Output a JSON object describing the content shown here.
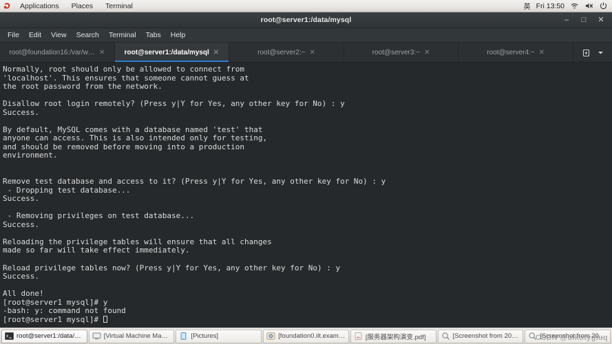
{
  "topbar": {
    "logo_icon": "fedora-logo-icon",
    "menus": [
      {
        "label": "Applications"
      },
      {
        "label": "Places"
      },
      {
        "label": "Terminal"
      }
    ],
    "ime_indicator": "英",
    "clock": "Fri 13:50",
    "icons": [
      {
        "name": "wifi-icon"
      },
      {
        "name": "volume-muted-icon"
      },
      {
        "name": "power-icon"
      }
    ]
  },
  "window": {
    "title": "root@server1:/data/mysql",
    "controls": {
      "minimize": "–",
      "maximize": "□",
      "close": "✕"
    },
    "menubar": [
      {
        "label": "File"
      },
      {
        "label": "Edit"
      },
      {
        "label": "View"
      },
      {
        "label": "Search"
      },
      {
        "label": "Terminal"
      },
      {
        "label": "Tabs"
      },
      {
        "label": "Help"
      }
    ],
    "tabs": [
      {
        "label": "root@foundation16:/var/w…",
        "active": false,
        "close": "✕"
      },
      {
        "label": "root@server1:/data/mysql",
        "active": true,
        "close": "✕"
      },
      {
        "label": "root@server2:~",
        "active": false,
        "close": "✕"
      },
      {
        "label": "root@server3:~",
        "active": false,
        "close": "✕"
      },
      {
        "label": "root@server4:~",
        "active": false,
        "close": "✕"
      }
    ],
    "tab_tools": [
      {
        "name": "new-tab-icon"
      },
      {
        "name": "chevron-down-icon"
      }
    ]
  },
  "terminal": {
    "accent_blue": "#2d7fd0",
    "background": "#26292b",
    "foreground": "#dcdcdc",
    "output": "Normally, root should only be allowed to connect from\n'localhost'. This ensures that someone cannot guess at\nthe root password from the network.\n\nDisallow root login remotely? (Press y|Y for Yes, any other key for No) : y\nSuccess.\n\nBy default, MySQL comes with a database named 'test' that\nanyone can access. This is also intended only for testing,\nand should be removed before moving into a production\nenvironment.\n\n\nRemove test database and access to it? (Press y|Y for Yes, any other key for No) : y\n - Dropping test database...\nSuccess.\n\n - Removing privileges on test database...\nSuccess.\n\nReloading the privilege tables will ensure that all changes\nmade so far will take effect immediately.\n\nReload privilege tables now? (Press y|Y for Yes, any other key for No) : y\nSuccess.\n\nAll done!\n[root@server1 mysql]# y\n-bash: y: command not found\n",
    "prompt": "[root@server1 mysql]# "
  },
  "taskbar": {
    "items": [
      {
        "label": "root@server1:/data/m...",
        "icon": "terminal-icon",
        "active": true
      },
      {
        "label": "[Virtual Machine Manag...",
        "icon": "vmm-icon",
        "active": false
      },
      {
        "label": "[Pictures]",
        "icon": "folder-icon",
        "active": false
      },
      {
        "label": "[foundation0.ilt.exampl...",
        "icon": "vm-icon",
        "active": false
      },
      {
        "label": "[服务器架构演变.pdf]",
        "icon": "pdf-icon",
        "active": false
      },
      {
        "label": "[Screenshot from 202...",
        "icon": "image-viewer-icon",
        "active": false
      },
      {
        "label": "[Screenshot from 202...",
        "icon": "image-viewer-icon",
        "active": false
      }
    ]
  },
  "watermark": {
    "text": "CSDN @uikotygiuq"
  }
}
